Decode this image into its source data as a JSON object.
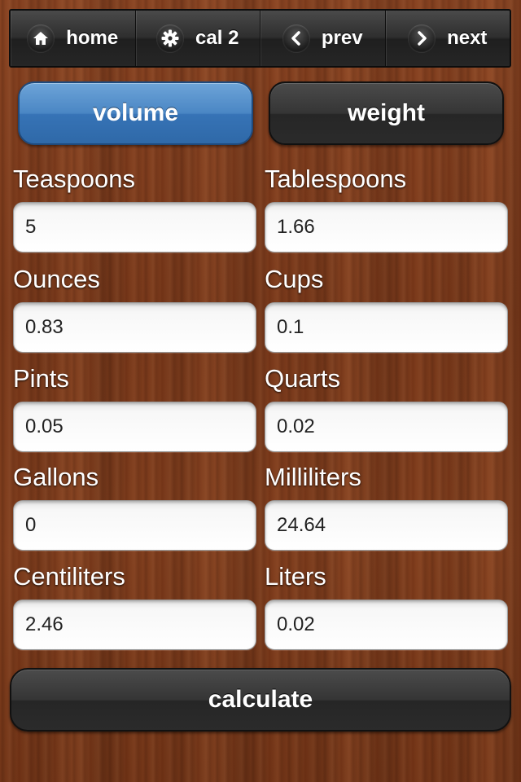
{
  "nav": {
    "home_label": "home",
    "home_icon": "home-icon",
    "cal2_label": "cal 2",
    "cal2_icon": "gear-icon",
    "prev_label": "prev",
    "prev_icon": "chevron-left-icon",
    "next_label": "next",
    "next_icon": "chevron-right-icon"
  },
  "tabs": {
    "volume_label": "volume",
    "weight_label": "weight",
    "selected": "volume"
  },
  "fields": {
    "teaspoons": {
      "label": "Teaspoons",
      "value": "5"
    },
    "tablespoons": {
      "label": "Tablespoons",
      "value": "1.66"
    },
    "ounces": {
      "label": "Ounces",
      "value": "0.83"
    },
    "cups": {
      "label": "Cups",
      "value": "0.1"
    },
    "pints": {
      "label": "Pints",
      "value": "0.05"
    },
    "quarts": {
      "label": "Quarts",
      "value": "0.02"
    },
    "gallons": {
      "label": "Gallons",
      "value": "0"
    },
    "milliliters": {
      "label": "Milliliters",
      "value": "24.64"
    },
    "centiliters": {
      "label": "Centiliters",
      "value": "2.46"
    },
    "liters": {
      "label": "Liters",
      "value": "0.02"
    }
  },
  "calculate_label": "calculate",
  "colors": {
    "accent": "#3f7bbd",
    "dark_button": "#2f2f2f"
  }
}
